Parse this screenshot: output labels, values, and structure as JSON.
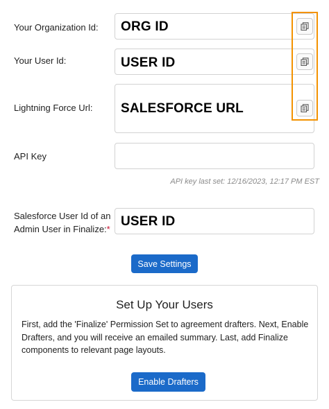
{
  "org": {
    "label": "Your Organization Id:",
    "value": "ORG ID",
    "copy_icon": "copy-icon"
  },
  "user": {
    "label": "Your User Id:",
    "value": "USER ID",
    "copy_icon": "copy-icon"
  },
  "lightning": {
    "label": "Lightning Force Url:",
    "value": "SALESFORCE URL",
    "copy_icon": "copy-icon"
  },
  "api": {
    "label": "API Key",
    "value": "",
    "last_set": "API key last set: 12/16/2023, 12:17 PM EST"
  },
  "admin": {
    "label_line1": "Salesforce User Id of an",
    "label_line2": "Admin User in Finalize:",
    "required_mark": "*",
    "value": "USER ID"
  },
  "save_button": "Save Settings",
  "setup": {
    "title": "Set Up Your Users",
    "description": "First, add the 'Finalize' Permission Set to agreement drafters. Next, Enable Drafters, and you will receive an emailed summary. Last, add Finalize components to relevant page layouts.",
    "button": "Enable Drafters"
  },
  "colors": {
    "button": "#1b6ac9",
    "highlight": "#f39200",
    "required": "#c8102e"
  }
}
